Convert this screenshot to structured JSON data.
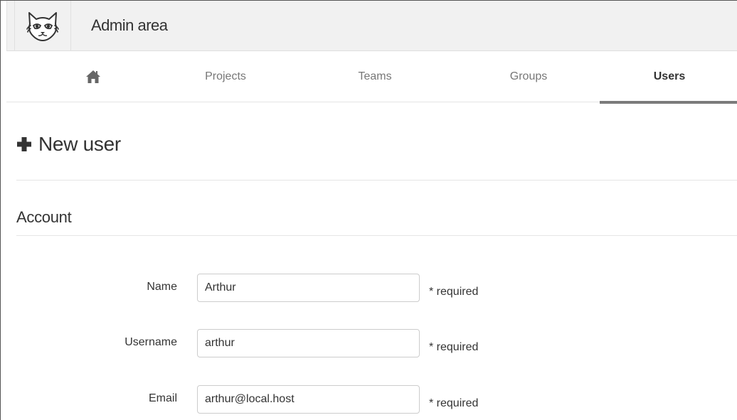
{
  "header": {
    "title": "Admin area",
    "logo_icon": "fox-logo-icon"
  },
  "nav": {
    "home_icon": "home-icon",
    "tabs": [
      {
        "label": "Projects"
      },
      {
        "label": "Teams"
      },
      {
        "label": "Groups"
      },
      {
        "label": "Users",
        "active": true
      }
    ]
  },
  "page": {
    "heading_icon": "plus-icon",
    "heading": "New user",
    "section": "Account"
  },
  "form": {
    "fields": [
      {
        "label": "Name",
        "value": "Arthur",
        "hint": "* required"
      },
      {
        "label": "Username",
        "value": "arthur",
        "hint": "* required"
      },
      {
        "label": "Email",
        "value": "arthur@local.host",
        "hint": "* required"
      }
    ]
  }
}
